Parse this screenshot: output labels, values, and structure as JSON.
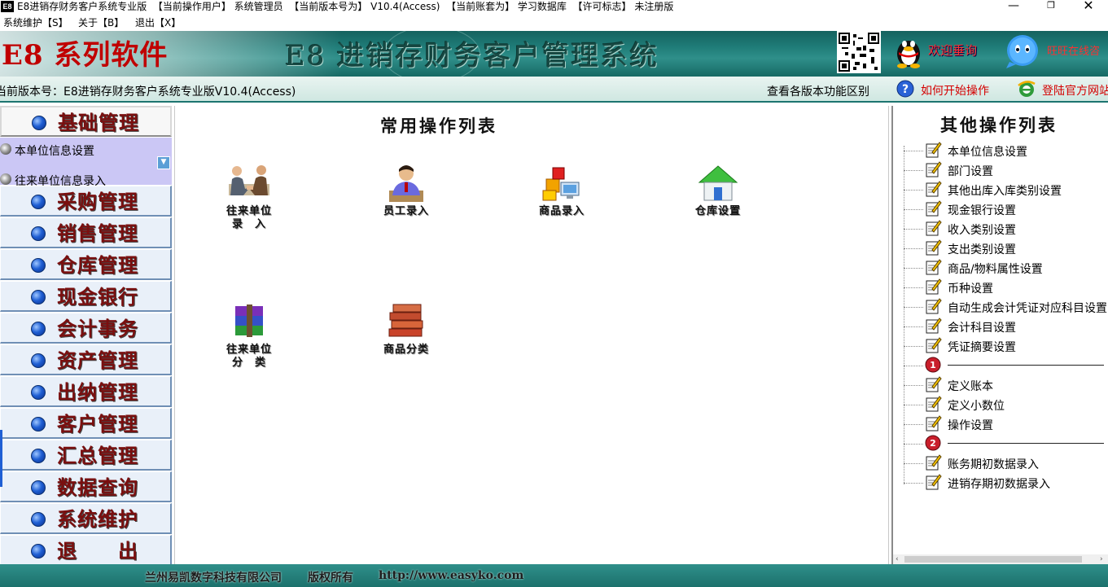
{
  "window": {
    "logo": "E8",
    "title": "E8进销存财务客户系统专业版  【当前操作用户】 系统管理员  【当前版本号为】 V10.4(Access)  【当前账套为】 学习数据库  【许可标志】 未注册版",
    "minimize": "—",
    "maximize": "❐",
    "close": "✕"
  },
  "menubar": {
    "items": [
      "系统维护【S】",
      "关于【B】",
      "退出【X】"
    ]
  },
  "banner": {
    "brand": "E8 系列软件",
    "title": "E8 进销存财务客户管理系统",
    "qq1_label": "欢迎垂询",
    "qq2_label": "旺旺在线咨"
  },
  "version_bar": {
    "version_text": "当前版本号：E8进销存财务客户系统专业版V10.4(Access)",
    "compare_link": "查看各版本功能区别",
    "help_link": "如何开始操作",
    "site_link": "登陆官方网站"
  },
  "left_nav": {
    "items": [
      "基础管理",
      "采购管理",
      "销售管理",
      "仓库管理",
      "现金银行",
      "会计事务",
      "资产管理",
      "出纳管理",
      "客户管理",
      "汇总管理",
      "数据查询",
      "系统维护",
      "退　　出"
    ],
    "basic_sub_items": [
      "本单位信息设置",
      "往来单位信息录入"
    ],
    "sub_scroll": "▼"
  },
  "center": {
    "title": "常用操作列表",
    "ops": [
      {
        "label": "往来单位\n录　入",
        "icon": "handshake-icon"
      },
      {
        "label": "员工录入",
        "icon": "employee-icon"
      },
      {
        "label": "商品录入",
        "icon": "goods-icon"
      },
      {
        "label": "仓库设置",
        "icon": "warehouse-icon"
      },
      {
        "label": "往来单位\n分　类",
        "icon": "archive-icon"
      },
      {
        "label": "商品分类",
        "icon": "books-icon"
      }
    ]
  },
  "right": {
    "title": "其他操作列表",
    "items": [
      "本单位信息设置",
      "部门设置",
      "其他出库入库类别设置",
      "现金银行设置",
      "收入类别设置",
      "支出类别设置",
      "商品/物料属性设置",
      "币种设置",
      "自动生成会计凭证对应科目设置",
      "会计科目设置",
      "凭证摘要设置",
      "",
      "定义账本",
      "定义小数位",
      "操作设置",
      "",
      "账务期初数据录入",
      "进销存期初数据录入"
    ],
    "sep1_badge": "1",
    "sep2_badge": "2",
    "scroll_left": "‹",
    "scroll_right": "›"
  },
  "footer": {
    "company": "兰州易凯数字科技有限公司",
    "rights": "版权所有",
    "url": "http://www.easyko.com"
  }
}
